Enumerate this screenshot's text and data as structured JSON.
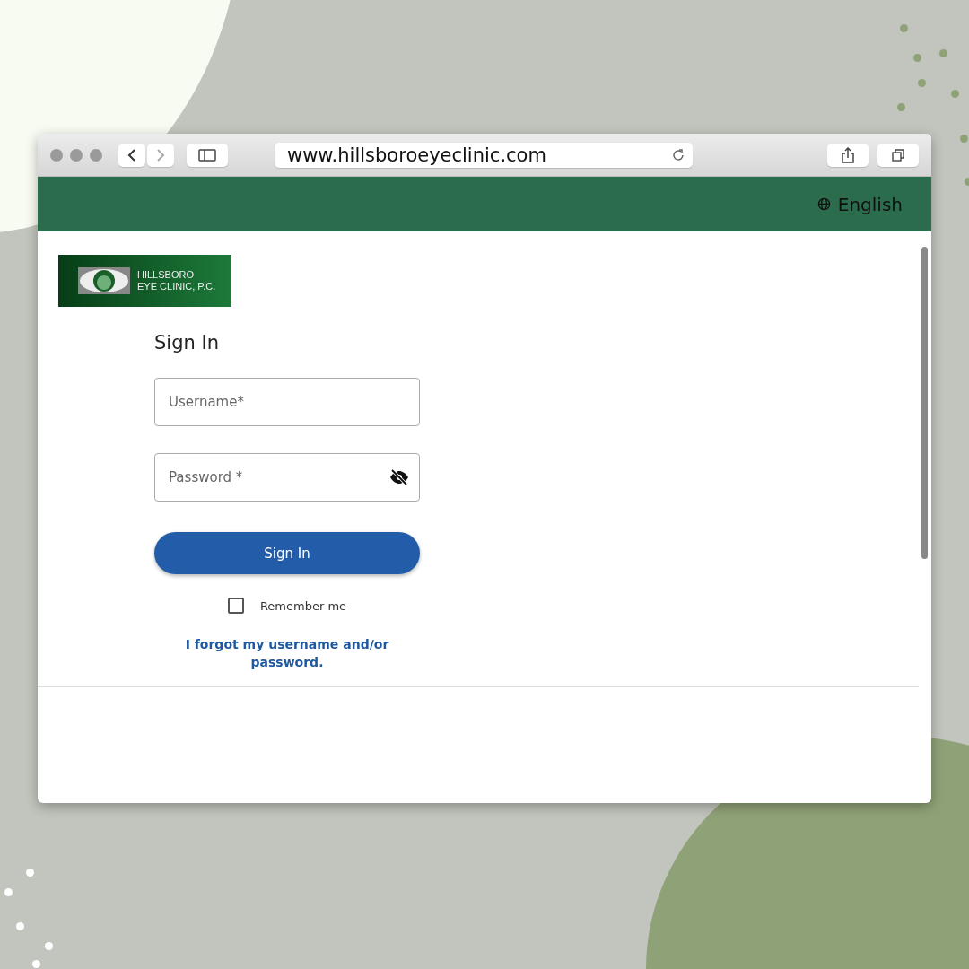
{
  "browser": {
    "url": "www.hillsboroeyeclinic.com"
  },
  "header": {
    "language": "English"
  },
  "logo": {
    "line_1": "HILLSBORO",
    "line_2": "EYE CLINIC, P.C."
  },
  "form": {
    "title": "Sign In",
    "fields": [
      {
        "placeholder": "Username*",
        "kind": "text"
      },
      {
        "placeholder": "Password *",
        "kind": "password"
      }
    ],
    "submit": "Sign In",
    "remember": {
      "label": "Remember me",
      "checked": false
    },
    "forgot_link": "I forgot my username and/or password."
  }
}
